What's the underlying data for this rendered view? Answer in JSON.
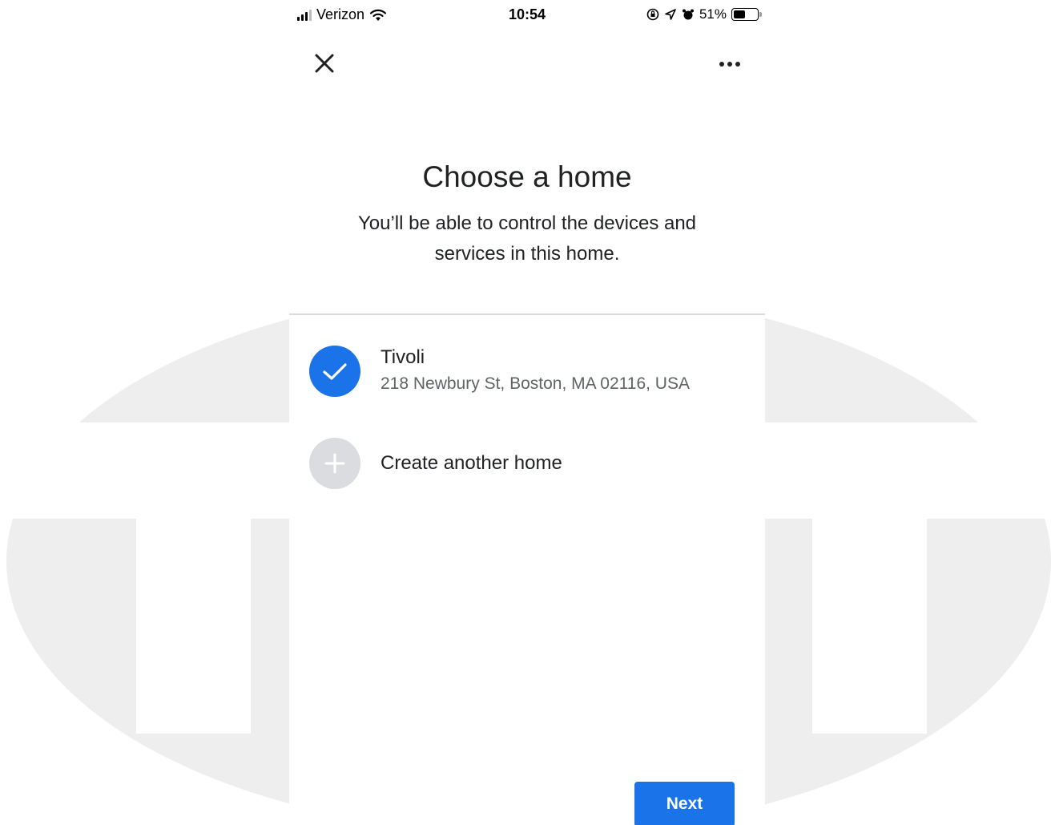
{
  "status_bar": {
    "carrier": "Verizon",
    "time": "10:54",
    "battery_percent": "51%",
    "battery_level": 0.51,
    "icons": [
      "signal-icon",
      "wifi-icon",
      "screen-lock-icon",
      "location-icon",
      "alarm-icon",
      "battery-icon"
    ]
  },
  "nav": {
    "close_icon": "close-icon",
    "more_icon": "more-options-icon"
  },
  "page": {
    "title": "Choose a home",
    "subtitle": "You’ll be able to control the devices and services in this home."
  },
  "homes": [
    {
      "name": "Tivoli",
      "address": "218 Newbury St, Boston, MA 02116, USA",
      "selected": true,
      "icon": "checkmark-icon"
    }
  ],
  "create_home": {
    "label": "Create another home",
    "icon": "plus-icon"
  },
  "footer": {
    "next_label": "Next"
  },
  "colors": {
    "accent": "#1a73e8",
    "watermark": "#eeeeee",
    "add_circle": "#dadce0",
    "text_primary": "#202124",
    "text_secondary": "#5f6368"
  }
}
